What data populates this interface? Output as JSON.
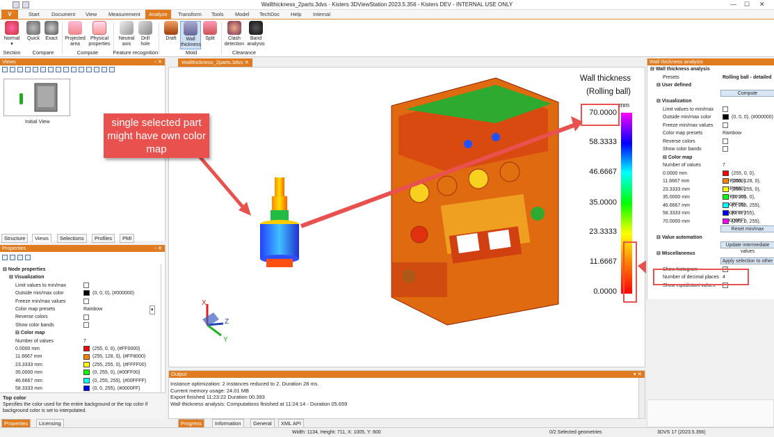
{
  "title_bar": {
    "title": "Wallthickness_2parts.3dvs - Kisters 3DViewStation 2023.5.356 - Kisters DEV - INTERNAL USE ONLY",
    "min": "—",
    "max": "☐",
    "close": "✕"
  },
  "menu": {
    "file": "V",
    "tabs": [
      "Start",
      "Document",
      "View",
      "Measurement",
      "Analyze",
      "Transform",
      "Tools",
      "Model",
      "TechDoc",
      "Help",
      "Internal"
    ],
    "active": "Analyze"
  },
  "ribbon": {
    "buttons": [
      {
        "label": "Normal",
        "sub": "▾"
      },
      {
        "label": "Quick"
      },
      {
        "label": "Exact"
      },
      {
        "label": "Projected area"
      },
      {
        "label": "Physical properties"
      },
      {
        "label": "Neutral axis"
      },
      {
        "label": "Drill hole"
      },
      {
        "label": "Draft"
      },
      {
        "label": "Wall thickness"
      },
      {
        "label": "Split"
      },
      {
        "label": "Clash detection"
      },
      {
        "label": "Band analysis"
      }
    ],
    "groups": [
      "Section",
      "Compare",
      "Compute",
      "Feature recognition",
      "Mold",
      "Clearance"
    ]
  },
  "views_panel": {
    "title": "Views",
    "pin": "▫ ✕",
    "thumb_label": "Initial View",
    "tabs": [
      "Structure",
      "Views",
      "Selections",
      "Profiles",
      "PMI"
    ],
    "active_tab": "Views"
  },
  "properties": {
    "title": "Properties",
    "pin": "▫ ✕",
    "rows": [
      {
        "k": "Node properties",
        "indent": 0,
        "section": true
      },
      {
        "k": "Visualization",
        "indent": 1,
        "section": true
      },
      {
        "k": "Limit values to min/max",
        "v": "",
        "cb": true
      },
      {
        "k": "Outside min/max color",
        "v": "(0, 0, 0), (#000000)",
        "sw": "#000000"
      },
      {
        "k": "Freeze min/max values",
        "v": "",
        "cb": true
      },
      {
        "k": "Color map presets",
        "v": "Rainbow",
        "dd": true
      },
      {
        "k": "Reverse colors",
        "v": "",
        "cb": true
      },
      {
        "k": "Show color bands",
        "v": "",
        "cb": true
      },
      {
        "k": "Color map",
        "indent": 2,
        "section": true
      },
      {
        "k": "Number of values",
        "v": "7"
      },
      {
        "k": "0.0000 mm",
        "v": "(255, 0, 0), (#FF0000)",
        "sw": "#FF0000"
      },
      {
        "k": "11.6667 mm",
        "v": "(255, 128, 0), (#FF8000)",
        "sw": "#FF8000"
      },
      {
        "k": "23.3333 mm",
        "v": "(255, 255, 0), (#FFFF00)",
        "sw": "#FFFF00"
      },
      {
        "k": "35.0000 mm",
        "v": "(0, 255, 0), (#00FF00)",
        "sw": "#00FF00"
      },
      {
        "k": "46.6667 mm",
        "v": "(0, 255, 255), (#00FFFF)",
        "sw": "#00FFFF"
      },
      {
        "k": "58.3333 mm",
        "v": "(0, 0, 255), (#0000FF)",
        "sw": "#0000FF"
      }
    ],
    "help_title": "Top color",
    "help_text": "Specifies the color used for the entire background or the top color if background color is set to interpolated.",
    "bottom_tabs": [
      "Properties",
      "Licensing"
    ]
  },
  "document_tab": "Wallthickness_2parts.3dvs",
  "legend": {
    "title": "Wall thickness",
    "subtitle": "(Rolling ball)",
    "unit": "mm",
    "values": [
      "70.0000",
      "58.3333",
      "46.6667",
      "35.0000",
      "23.3333",
      "11.6667",
      "0.0000"
    ]
  },
  "callout": "single selected part might have own color map",
  "triad": {
    "x": "X",
    "y": "Y",
    "z": "Z"
  },
  "output": {
    "title": "Output",
    "pin": "▾ ✕",
    "lines": [
      "Instance optimization: 2 instances reduced to 2. Duration 28 ms.",
      "Current memory usage: 24.01 MB",
      "Export finished 11:23:22 Duration 00.393",
      "Wall thickness analysis: Computations finished at 11:24:14  - Duration 05.659"
    ],
    "tabs": [
      "Progress",
      "Information",
      "General",
      "XML API"
    ],
    "active_tab": "Progress"
  },
  "wta": {
    "title": "Wall thickness analysis",
    "rows": [
      {
        "k": "Wall thickness analysis",
        "section": true,
        "indent": 0
      },
      {
        "k": "Presets",
        "v": "Rolling ball - detailed",
        "bold": true
      },
      {
        "k": "User defined",
        "section": true,
        "indent": 1
      },
      {
        "button": "Compute"
      },
      {
        "k": "Visualization",
        "section": true,
        "indent": 1
      },
      {
        "k": "Limit values to min/max",
        "cb": true
      },
      {
        "k": "Outside min/max color",
        "v": "(0, 0, 0), (#000000)",
        "sw": "#000000"
      },
      {
        "k": "Freeze min/max values",
        "cb": true
      },
      {
        "k": "Color map presets",
        "v": "Rainbow"
      },
      {
        "k": "Reverse colors",
        "cb": true
      },
      {
        "k": "Show color bands",
        "cb": true
      },
      {
        "k": "Color map",
        "section": true,
        "indent": 2
      },
      {
        "k": "Number of values",
        "v": "7"
      },
      {
        "k": "0.0000 mm",
        "v": "(255, 0, 0), (#FF0000)",
        "sw": "#FF0000"
      },
      {
        "k": "11.6667 mm",
        "v": "(255, 128, 0), (#FF8000)",
        "sw": "#FF8000"
      },
      {
        "k": "23.3333 mm",
        "v": "(255, 255, 0), (#FFFF00)",
        "sw": "#FFFF00"
      },
      {
        "k": "35.0000 mm",
        "v": "(0, 255, 0), (#00FF00)",
        "sw": "#00FF00"
      },
      {
        "k": "46.6667 mm",
        "v": "(0, 255, 255), (#00FFFF)",
        "sw": "#00FFFF"
      },
      {
        "k": "58.3333 mm",
        "v": "(0, 0, 255), (#0000FF)",
        "sw": "#0000FF"
      },
      {
        "k": "70.0000 mm",
        "v": "(255, 0, 255), (#FF00FF)",
        "sw": "#FF00FF"
      },
      {
        "button": "Reset min/max"
      },
      {
        "k": "Value automation",
        "section": true,
        "indent": 1
      },
      {
        "button": "Update intermediate values"
      },
      {
        "k": "Miscellaneous",
        "section": true,
        "indent": 1
      },
      {
        "button": "Apply selection to other"
      },
      {
        "k": "Show histogram",
        "cb": true,
        "checked": true
      },
      {
        "k": "Number of decimal places",
        "v": "4"
      },
      {
        "k": "Show equidistant values",
        "cb": true
      }
    ]
  },
  "status": {
    "dims": "Width: 1134, Height: 711, X: 1005, Y: 600",
    "sel": "0/2 Selected geometries",
    "ver": "3DVS 17 (2023.5.356)"
  },
  "colors": {
    "accent": "#e07b20",
    "callout": "#e8514e"
  }
}
